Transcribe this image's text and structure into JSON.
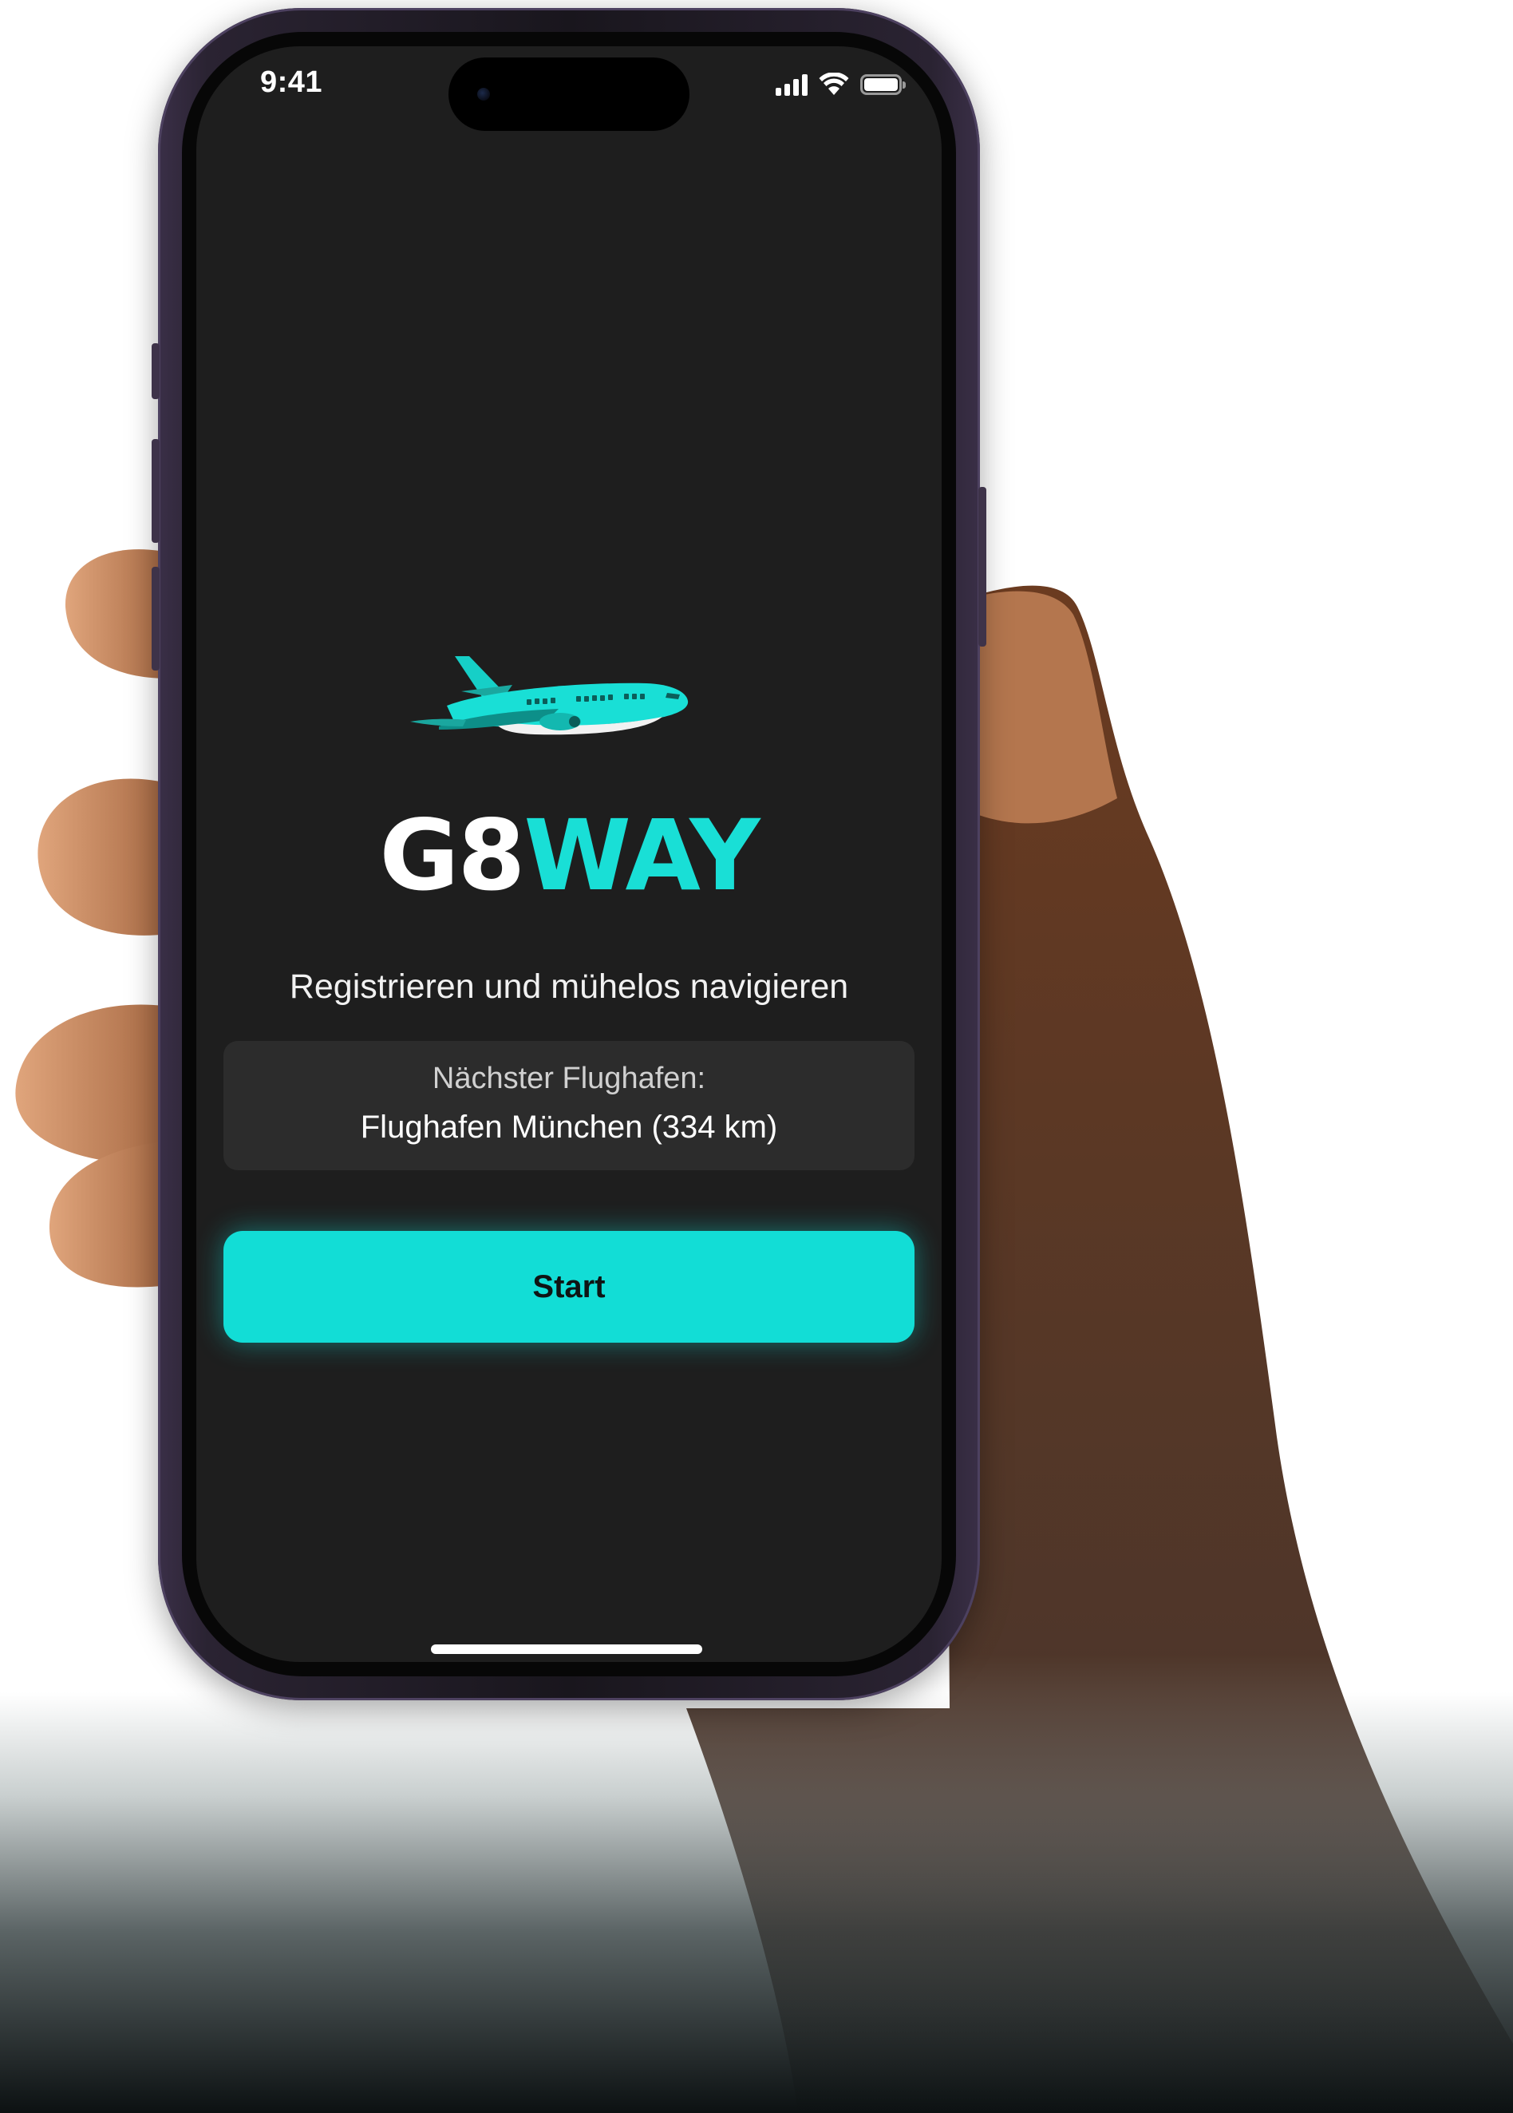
{
  "status_bar": {
    "time": "9:41",
    "battery_level": 1.0
  },
  "app": {
    "logo_part1": "G8",
    "logo_part2": "WAY",
    "subtitle": "Registrieren und mühelos navigieren",
    "nearest_airport": {
      "label": "Nächster Flughafen:",
      "value": "Flughafen München (334 km)"
    },
    "start_button_label": "Start"
  },
  "colors": {
    "accent": "#12ddd6",
    "screen_background": "#1e1e1e",
    "card_background": "#2c2c2c"
  },
  "icons": {
    "status": [
      "cellular-signal-icon",
      "wifi-icon",
      "battery-icon"
    ],
    "hero": "airplane-icon"
  }
}
